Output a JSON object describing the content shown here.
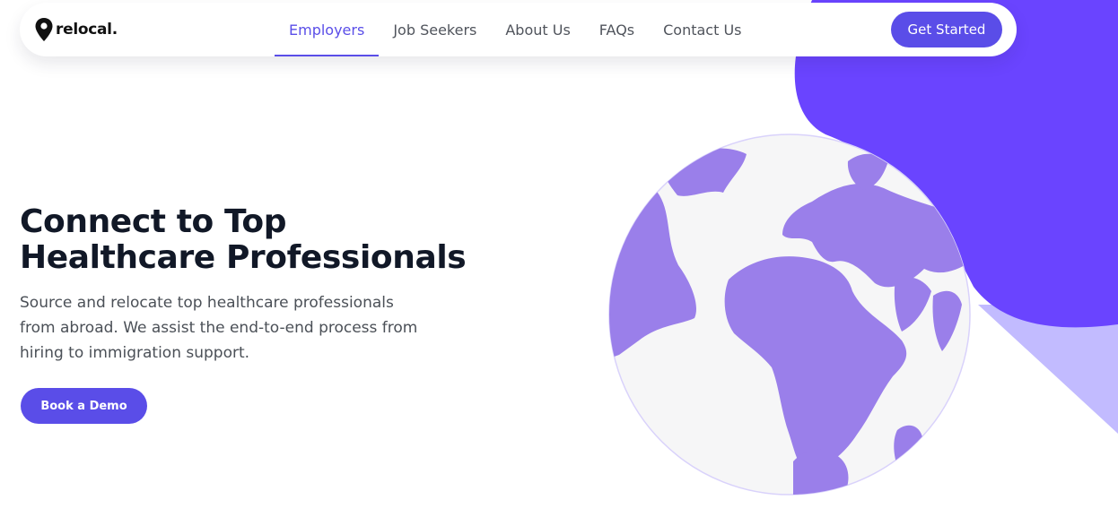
{
  "logo": {
    "text": "relocal."
  },
  "nav": {
    "items": [
      {
        "label": "Employers",
        "active": true
      },
      {
        "label": "Job Seekers",
        "active": false
      },
      {
        "label": "About Us",
        "active": false
      },
      {
        "label": "FAQs",
        "active": false
      },
      {
        "label": "Contact Us",
        "active": false
      }
    ],
    "cta_label": "Get Started"
  },
  "hero": {
    "title_line1": "Connect to Top",
    "title_line2": "Healthcare Professionals",
    "subtitle": "Source and relocate top healthcare professionals from abroad. We assist the end-to-end process from hiring to immigration support.",
    "cta_label": "Book a Demo"
  },
  "illustration": {
    "icon": "globe-illustration"
  },
  "colors": {
    "accent": "#5a4de8",
    "blob": "#6a44ff",
    "triangle": "#c2bbff",
    "land": "#9a7fea",
    "ocean": "#f6f6f7"
  }
}
